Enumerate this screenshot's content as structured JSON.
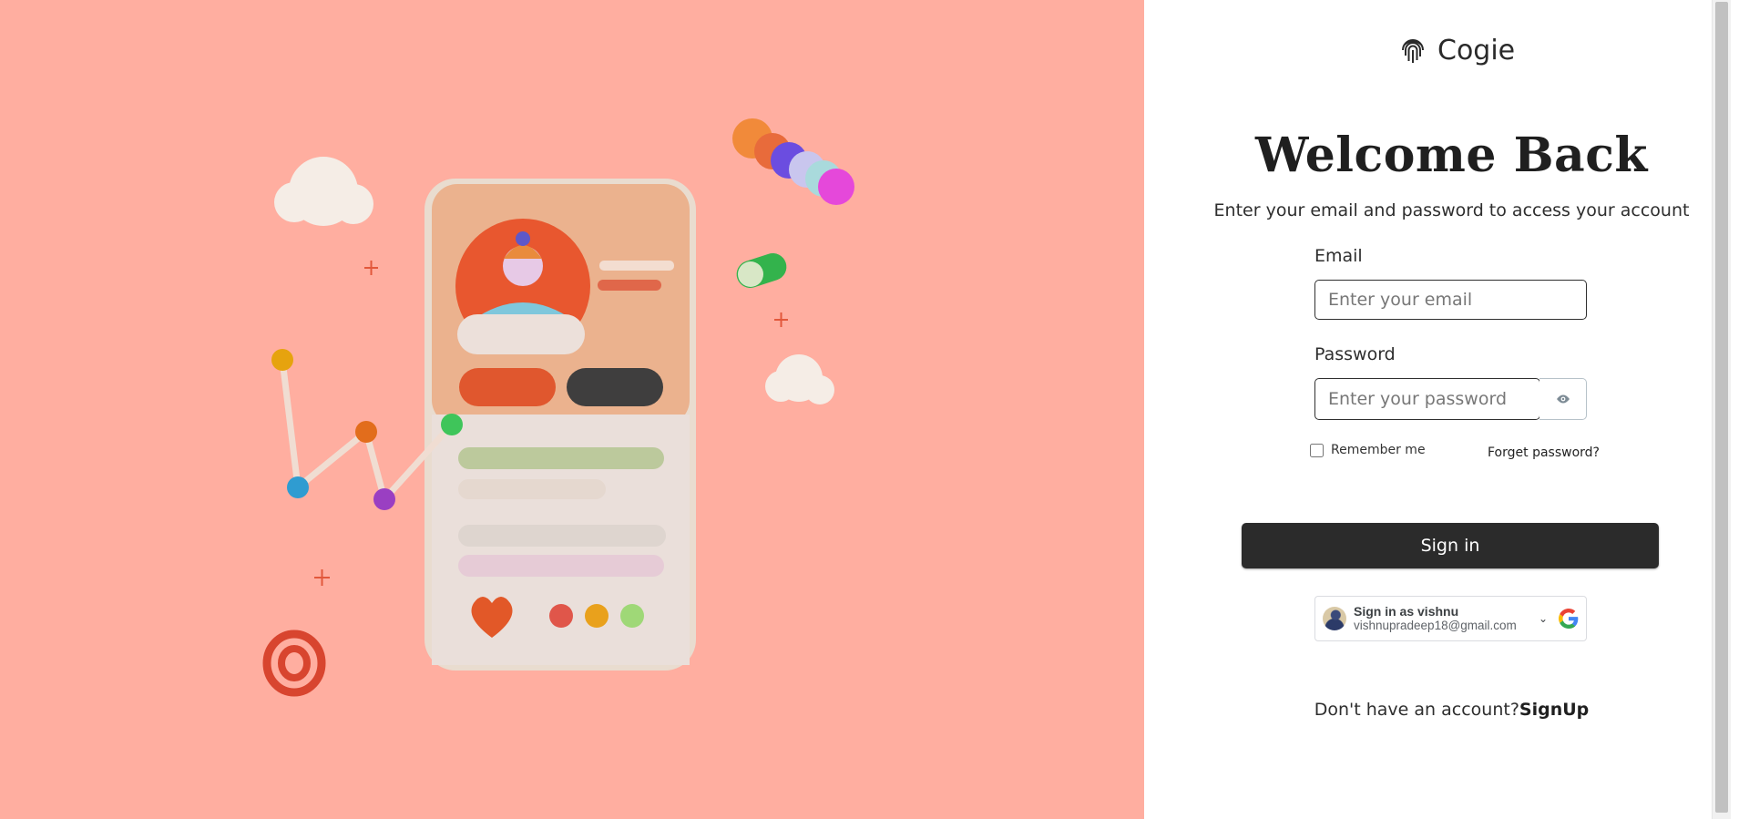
{
  "brand": {
    "name": "Cogie",
    "logo_icon": "fingerprint-icon"
  },
  "heading": {
    "title": "Welcome Back",
    "subtitle": "Enter your email and password to access your account"
  },
  "form": {
    "email_label": "Email",
    "email_placeholder": "Enter your email",
    "password_label": "Password",
    "password_placeholder": "Enter your password",
    "toggle_icon": "eye-icon",
    "remember_label": "Remember me",
    "forgot_label": "Forget password?",
    "submit_label": "Sign in"
  },
  "google": {
    "title": "Sign in as vishnu",
    "email": "vishnupradeep18@gmail.com",
    "icon": "google-icon"
  },
  "footer": {
    "prompt": "Don't have an account?",
    "link_label": "SignUp"
  },
  "colors": {
    "left_background": "#ffaea0",
    "accent": "#2b2b2b",
    "phone_orange": "#e8572f"
  }
}
